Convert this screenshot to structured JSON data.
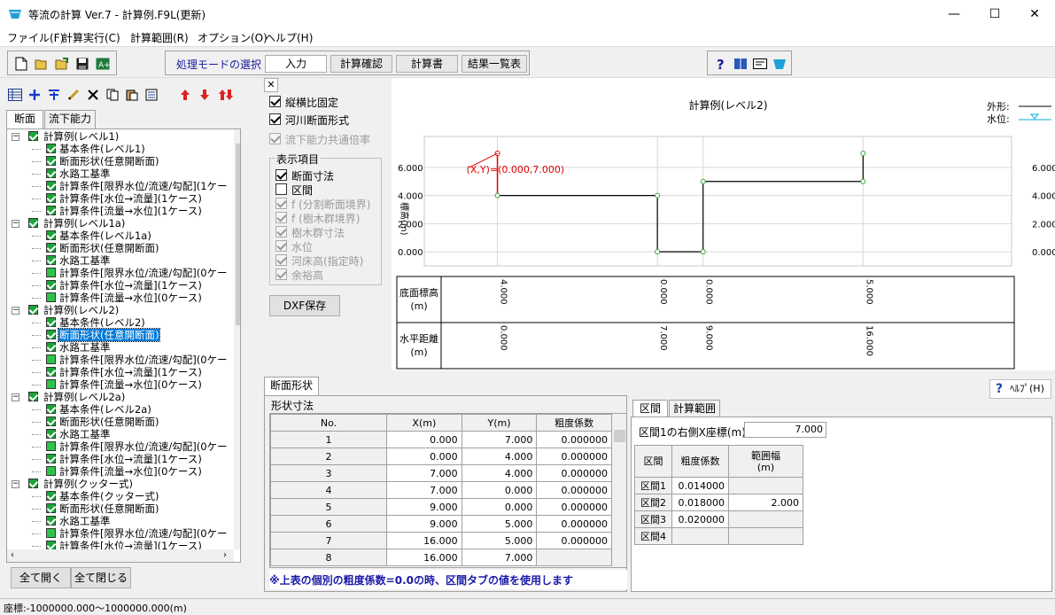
{
  "window": {
    "title": "等流の計算 Ver.7 - 計算例.F9L(更新)",
    "minimize": "—",
    "maximize": "☐",
    "close": "✕"
  },
  "menu": [
    "ファイル(F)",
    "計算実行(C)",
    "計算範囲(R)",
    "オプション(O)",
    "ヘルプ(H)"
  ],
  "mode": {
    "label": "処理モードの選択",
    "buttons": [
      "入力",
      "計算確認",
      "計算書",
      "結果一覧表"
    ]
  },
  "tree": {
    "tabs": [
      "断面",
      "流下能力"
    ],
    "items": [
      {
        "level": 0,
        "text": "計算例(レベル1)"
      },
      {
        "level": 1,
        "text": "基本条件(レベル1)"
      },
      {
        "level": 1,
        "text": "断面形状(任意開断面)"
      },
      {
        "level": 1,
        "text": "水路工基準"
      },
      {
        "level": 1,
        "text": "計算条件[限界水位/流速/勾配](1ケー"
      },
      {
        "level": 1,
        "text": "計算条件[水位→流量](1ケース)"
      },
      {
        "level": 1,
        "text": "計算条件[流量→水位](1ケース)"
      },
      {
        "level": 0,
        "text": "計算例(レベル1a)"
      },
      {
        "level": 1,
        "text": "基本条件(レベル1a)"
      },
      {
        "level": 1,
        "text": "断面形状(任意開断面)"
      },
      {
        "level": 1,
        "text": "水路工基準"
      },
      {
        "level": 1,
        "text": "計算条件[限界水位/流速/勾配](0ケー",
        "plain": true
      },
      {
        "level": 1,
        "text": "計算条件[水位→流量](1ケース)"
      },
      {
        "level": 1,
        "text": "計算条件[流量→水位](0ケース)",
        "plain": true
      },
      {
        "level": 0,
        "text": "計算例(レベル2)"
      },
      {
        "level": 1,
        "text": "基本条件(レベル2)"
      },
      {
        "level": 1,
        "text": "断面形状(任意開断面)",
        "selected": true
      },
      {
        "level": 1,
        "text": "水路工基準"
      },
      {
        "level": 1,
        "text": "計算条件[限界水位/流速/勾配](0ケー",
        "plain": true
      },
      {
        "level": 1,
        "text": "計算条件[水位→流量](1ケース)"
      },
      {
        "level": 1,
        "text": "計算条件[流量→水位](0ケース)",
        "plain": true
      },
      {
        "level": 0,
        "text": "計算例(レベル2a)"
      },
      {
        "level": 1,
        "text": "基本条件(レベル2a)"
      },
      {
        "level": 1,
        "text": "断面形状(任意開断面)"
      },
      {
        "level": 1,
        "text": "水路工基準"
      },
      {
        "level": 1,
        "text": "計算条件[限界水位/流速/勾配](0ケー",
        "plain": true
      },
      {
        "level": 1,
        "text": "計算条件[水位→流量](1ケース)"
      },
      {
        "level": 1,
        "text": "計算条件[流量→水位](0ケース)",
        "plain": true
      },
      {
        "level": 0,
        "text": "計算例(クッター式)"
      },
      {
        "level": 1,
        "text": "基本条件(クッター式)"
      },
      {
        "level": 1,
        "text": "断面形状(任意開断面)"
      },
      {
        "level": 1,
        "text": "水路工基準"
      },
      {
        "level": 1,
        "text": "計算条件[限界水位/流速/勾配](0ケー",
        "plain": true
      },
      {
        "level": 1,
        "text": "計算条件[水位→流量](1ケース)"
      }
    ],
    "expand_all": "全て開く",
    "collapse_all": "全て閉じる"
  },
  "options": {
    "close_x": "✕",
    "fix_aspect": "縦横比固定",
    "river_section": "河川断面形式",
    "common_ratio": "流下能力共通倍率",
    "display_group": "表示項目",
    "display_items": [
      {
        "text": "断面寸法",
        "checked": true,
        "disabled": false
      },
      {
        "text": "区間",
        "checked": false,
        "disabled": false
      },
      {
        "text": "f (分割断面境界)",
        "checked": true,
        "disabled": true
      },
      {
        "text": "f (樹木群境界)",
        "checked": true,
        "disabled": true
      },
      {
        "text": "樹木群寸法",
        "checked": true,
        "disabled": true
      },
      {
        "text": "水位",
        "checked": true,
        "disabled": true
      },
      {
        "text": "河床高(指定時)",
        "checked": true,
        "disabled": true
      },
      {
        "text": "余裕高",
        "checked": true,
        "disabled": true
      }
    ],
    "dxf_save": "DXF保存"
  },
  "chart_data": {
    "type": "line",
    "title": "計算例(レベル2)",
    "ylabel": "標高(m)",
    "ylim": [
      -1.0,
      8.2
    ],
    "xlim": [
      -3.2,
      22.5
    ],
    "yticks": [
      "6.000",
      "4.000",
      "2.000",
      "0.000"
    ],
    "ytick_values": [
      6,
      4,
      2,
      0
    ],
    "series": [
      {
        "name": "外形",
        "x": [
          0,
          0,
          7,
          7,
          9,
          9,
          16,
          16
        ],
        "y": [
          7,
          4,
          4,
          0,
          0,
          5,
          5,
          7
        ]
      }
    ],
    "annotation": "(X,Y)=(0.000,7.000)",
    "legend": [
      "外形",
      "水位"
    ],
    "table_rows": [
      "底面標高\n(m)",
      "水平距離\n(m)"
    ],
    "elevations": [
      "4.000",
      "0.000",
      "0.000",
      "5.000"
    ],
    "distances": [
      "0.000",
      "7.000",
      "9.000",
      "16.000"
    ],
    "label_x": [
      0,
      7,
      9,
      16
    ],
    "colors": {
      "outline": "#e00000",
      "point": "#33aa33",
      "water": "#00b0d0"
    }
  },
  "bottom": {
    "tab": "断面形状",
    "help": "ﾍﾙﾌﾟ(H)",
    "group": "形状寸法",
    "headers": [
      "No.",
      "X(m)",
      "Y(m)",
      "粗度係数"
    ],
    "rows": [
      [
        "1",
        "0.000",
        "7.000",
        "0.000000"
      ],
      [
        "2",
        "0.000",
        "4.000",
        "0.000000"
      ],
      [
        "3",
        "7.000",
        "4.000",
        "0.000000"
      ],
      [
        "4",
        "7.000",
        "0.000",
        "0.000000"
      ],
      [
        "5",
        "9.000",
        "0.000",
        "0.000000"
      ],
      [
        "6",
        "9.000",
        "5.000",
        "0.000000"
      ],
      [
        "7",
        "16.000",
        "5.000",
        "0.000000"
      ],
      [
        "8",
        "16.000",
        "7.000",
        ""
      ]
    ],
    "note": "※上表の個別の粗度係数=0.0の時、区間タブの値を使用します",
    "right_tabs": [
      "区間",
      "計算範囲"
    ],
    "first_x_label": "区間1の右側X座標(m)",
    "first_x_value": "7.000",
    "sec_headers": [
      "区間",
      "粗度係数",
      "範囲幅\n(m)"
    ],
    "sections": [
      [
        "区間1",
        "0.014000",
        ""
      ],
      [
        "区間2",
        "0.018000",
        "2.000"
      ],
      [
        "区間3",
        "0.020000",
        ""
      ],
      [
        "区間4",
        "",
        ""
      ]
    ]
  },
  "status": "座標:-1000000.000～1000000.000(m)"
}
